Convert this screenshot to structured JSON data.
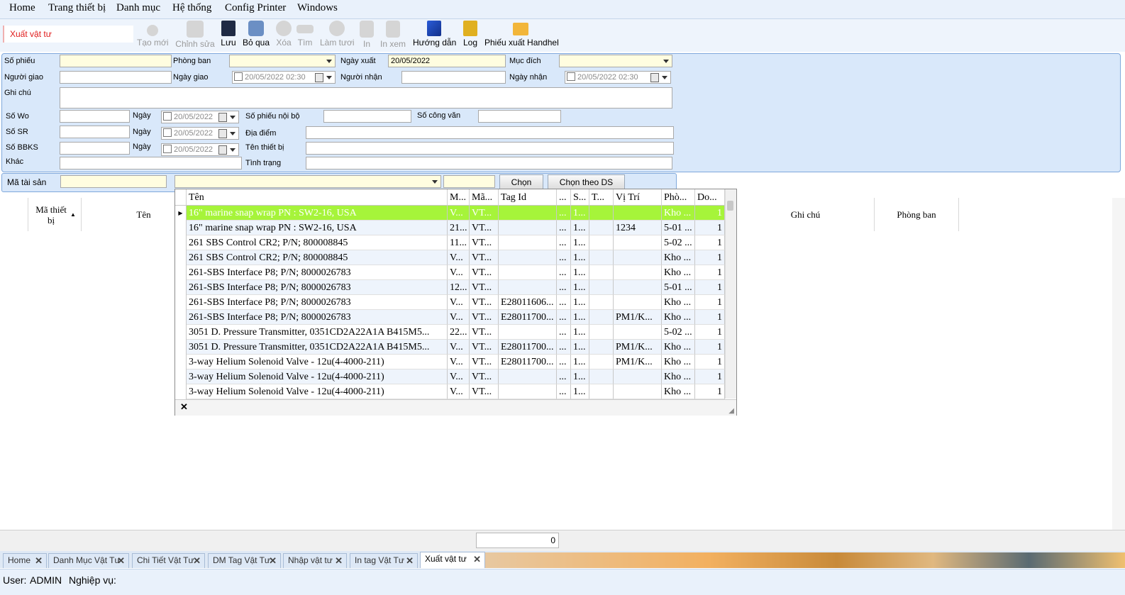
{
  "menu": [
    "Home",
    "Trang thiết bị",
    "Danh mục",
    "Hệ thống",
    "Config Printer",
    "Windows"
  ],
  "form_title": "Xuất vật tư",
  "toolbar": [
    {
      "label": "Tạo mới",
      "icon": "add-icon",
      "enabled": false
    },
    {
      "label": "Chỉnh sửa",
      "icon": "edit-icon",
      "enabled": false
    },
    {
      "label": "Lưu",
      "icon": "save-icon",
      "enabled": true
    },
    {
      "label": "Bỏ qua",
      "icon": "cancel-icon",
      "enabled": true
    },
    {
      "label": "Xóa",
      "icon": "delete-icon",
      "enabled": false
    },
    {
      "label": "Tìm",
      "icon": "find-icon",
      "enabled": false
    },
    {
      "label": "Làm tươi",
      "icon": "refresh-icon",
      "enabled": false
    },
    {
      "label": "In",
      "icon": "print-icon",
      "enabled": false
    },
    {
      "label": "In xem",
      "icon": "print-preview-icon",
      "enabled": false
    },
    {
      "label": "Hướng dẫn",
      "icon": "guide-icon",
      "enabled": true
    },
    {
      "label": "Log",
      "icon": "log-icon",
      "enabled": true
    },
    {
      "label": "Phiếu xuất Handhel",
      "icon": "folder-icon",
      "enabled": true
    }
  ],
  "form": {
    "so_phieu_label": "Số phiếu",
    "so_phieu": "",
    "phong_ban_label": "Phòng ban",
    "phong_ban": "",
    "ngay_xuat_label": "Ngày xuất",
    "ngay_xuat": "20/05/2022",
    "muc_dich_label": "Mục đích",
    "muc_dich": "",
    "nguoi_giao_label": "Người giao",
    "nguoi_giao": "",
    "ngay_giao_label": "Ngày giao",
    "ngay_giao": "20/05/2022 02:30",
    "nguoi_nhan_label": "Người nhận",
    "nguoi_nhan": "",
    "ngay_nhan_label": "Ngày nhận",
    "ngay_nhan": "20/05/2022 02:30",
    "ghi_chu_label": "Ghi chú",
    "ghi_chu": "",
    "so_wo_label": "Số Wo",
    "so_wo": "",
    "ngay_label": "Ngày",
    "ngay_wo": "20/05/2022",
    "so_phieu_noi_bo_label": "Số phiếu nội bộ",
    "so_phieu_noi_bo": "",
    "so_cong_van_label": "Số công văn",
    "so_cong_van": "",
    "so_sr_label": "Số SR",
    "so_sr": "",
    "ngay_sr": "20/05/2022",
    "dia_diem_label": "Địa điểm",
    "dia_diem": "",
    "so_bbks_label": "Số BBKS",
    "so_bbks": "",
    "ngay_bbks": "20/05/2022",
    "ten_thiet_bi_label": "Tên thiết bị",
    "ten_thiet_bi": "",
    "khac_label": "Khác",
    "khac": "",
    "tinh_trang_label": "Tình trạng",
    "tinh_trang": ""
  },
  "asset": {
    "ma_tai_san_label": "Mã tài sản",
    "ma_tai_san": "",
    "combo": "",
    "qty": "",
    "chon_label": "Chọn",
    "chon_theo_ds_label": "Chọn theo DS"
  },
  "grid_headers": [
    "Mã thiết bị",
    "Tên",
    "Ghi chú",
    "Phòng ban"
  ],
  "footer_count": "0",
  "popup": {
    "headers": [
      "Tên",
      "M...",
      "Mã...",
      "Tag Id",
      "...",
      "S...",
      "T...",
      "Vị Trí",
      "Phò...",
      "Do..."
    ],
    "rows": [
      [
        "16\" marine snap wrap PN : SW2-16, USA",
        "V...",
        "VT...",
        "",
        "...",
        "1...",
        "",
        "",
        "Kho ...",
        "1"
      ],
      [
        "16\" marine snap wrap PN : SW2-16, USA",
        "21...",
        "VT...",
        "",
        "...",
        "1...",
        "",
        "1234",
        "5-01 ...",
        "1"
      ],
      [
        "261 SBS Control CR2; P/N; 800008845",
        "11...",
        "VT...",
        "",
        "...",
        "1...",
        "",
        "",
        "5-02 ...",
        "1"
      ],
      [
        "261 SBS Control CR2; P/N; 800008845",
        "V...",
        "VT...",
        "",
        "...",
        "1...",
        "",
        "",
        "Kho ...",
        "1"
      ],
      [
        "261-SBS Interface P8; P/N; 8000026783",
        "V...",
        "VT...",
        "",
        "...",
        "1...",
        "",
        "",
        "Kho ...",
        "1"
      ],
      [
        "261-SBS Interface P8; P/N; 8000026783",
        "12...",
        "VT...",
        "",
        "...",
        "1...",
        "",
        "",
        "5-01 ...",
        "1"
      ],
      [
        "261-SBS Interface P8; P/N; 8000026783",
        "V...",
        "VT...",
        "E28011606...",
        "...",
        "1...",
        "",
        "",
        "Kho ...",
        "1"
      ],
      [
        "261-SBS Interface P8; P/N; 8000026783",
        "V...",
        "VT...",
        "E28011700...",
        "...",
        "1...",
        "",
        "PM1/K...",
        "Kho ...",
        "1"
      ],
      [
        "3051 D. Pressure Transmitter, 0351CD2A22A1A B415M5...",
        "22...",
        "VT...",
        "",
        "...",
        "1...",
        "",
        "",
        "5-02 ...",
        "1"
      ],
      [
        "3051 D. Pressure Transmitter, 0351CD2A22A1A B415M5...",
        "V...",
        "VT...",
        "E28011700...",
        "...",
        "1...",
        "",
        "PM1/K...",
        "Kho ...",
        "1"
      ],
      [
        "3-way Helium Solenoid Valve - 12u(4-4000-211)",
        "V...",
        "VT...",
        "E28011700...",
        "...",
        "1...",
        "",
        "PM1/K...",
        "Kho ...",
        "1"
      ],
      [
        "3-way Helium Solenoid Valve - 12u(4-4000-211)",
        "V...",
        "VT...",
        "",
        "...",
        "1...",
        "",
        "",
        "Kho ...",
        "1"
      ],
      [
        "3-way Helium Solenoid Valve - 12u(4-4000-211)",
        "V...",
        "VT...",
        "",
        "...",
        "1...",
        "",
        "",
        "Kho ...",
        "1"
      ]
    ],
    "close": "✕"
  },
  "tabs": [
    "Home",
    "Danh Mục Vật Tư",
    "Chi Tiết Vật Tư",
    "DM Tag Vật Tư",
    "Nhập vật tư",
    "In tag Vật Tư",
    "Xuất vật tư"
  ],
  "tab_close": "✕",
  "status": {
    "user_label": "User:",
    "user": "ADMIN",
    "nghiep_vu_label": "Nghiệp vụ:"
  }
}
